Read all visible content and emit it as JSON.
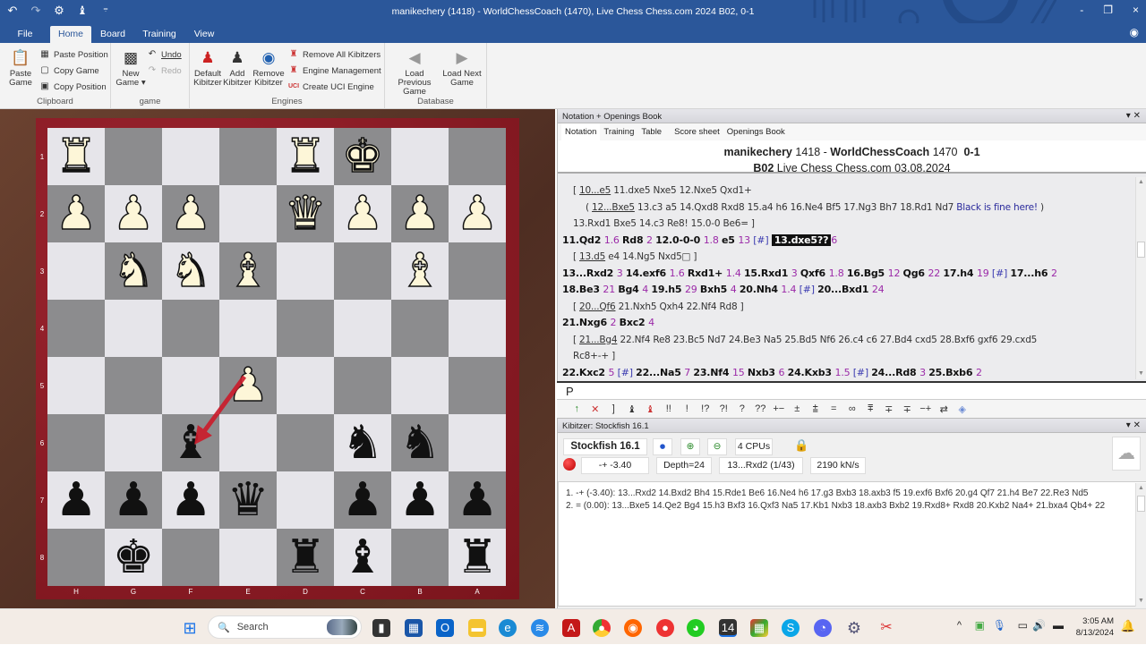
{
  "window": {
    "title": "manikechery (1418) - WorldChessCoach (1470), Live Chess Chess.com 2024  B02, 0-1",
    "qat_icons": [
      "undo-icon",
      "redo-icon",
      "settings-gear-icon",
      "tools-icon",
      "customize-icon"
    ],
    "controls": {
      "minimize": "-",
      "restore": "❐",
      "close": "×"
    }
  },
  "menu": {
    "tabs": [
      {
        "label": "File",
        "active": false
      },
      {
        "label": "Home",
        "active": true
      },
      {
        "label": "Board",
        "active": false
      },
      {
        "label": "Training",
        "active": false
      },
      {
        "label": "View",
        "active": false
      }
    ]
  },
  "ribbon": {
    "clipboard": {
      "label": "Clipboard",
      "paste_game": "Paste Game",
      "paste_position": "Paste Position",
      "copy_game": "Copy Game",
      "copy_position": "Copy Position"
    },
    "game": {
      "label": "game",
      "new_game": "New Game",
      "undo": "Undo",
      "redo": "Redo"
    },
    "engines": {
      "label": "Engines",
      "default_kibitzer": "Default Kibitzer",
      "add_kibitzer": "Add Kibitzer",
      "remove_kibitzer": "Remove Kibitzer",
      "remove_all_kibitzers": "Remove All Kibitzers",
      "engine_management": "Engine Management",
      "create_uci_engine": "Create UCI Engine"
    },
    "database": {
      "label": "Database",
      "load_previous": "Load Previous Game",
      "load_next": "Load Next Game"
    }
  },
  "board": {
    "orientation": "black",
    "rank_labels": [
      "1",
      "2",
      "3",
      "4",
      "5",
      "6",
      "7",
      "8"
    ],
    "file_labels": [
      "H",
      "G",
      "F",
      "E",
      "D",
      "C",
      "B",
      "A"
    ],
    "rows": [
      [
        "wR",
        "",
        "",
        "",
        "wR",
        "wK",
        "",
        ""
      ],
      [
        "wP",
        "wP",
        "wP",
        "",
        "wQ",
        "wP",
        "wP",
        "wP"
      ],
      [
        "",
        "wN",
        "wN",
        "wB",
        "",
        "",
        "wB",
        ""
      ],
      [
        "",
        "",
        "",
        "",
        "",
        "",
        "",
        ""
      ],
      [
        "",
        "",
        "",
        "wP",
        "",
        "",
        "",
        ""
      ],
      [
        "",
        "",
        "bB",
        "",
        "",
        "bN",
        "bN",
        ""
      ],
      [
        "bP",
        "bP",
        "bP",
        "bQ",
        "",
        "bP",
        "bP",
        "bP"
      ],
      [
        "",
        "bK",
        "",
        "",
        "bR",
        "bB",
        "",
        "bR"
      ]
    ],
    "arrow": {
      "from": "e5",
      "to": "f6",
      "color": "#cc1a2a"
    }
  },
  "notation": {
    "panel_title": "Notation + Openings Book",
    "tabs": [
      "Notation",
      "Training",
      "Table",
      "Score sheet",
      "Openings Book"
    ],
    "active_tab": "Notation",
    "white_player": "manikechery",
    "white_elo": "1418",
    "black_player": "WorldChessCoach",
    "black_elo": "1470",
    "result": "0-1",
    "eco": "B02",
    "event": "Live Chess Chess.com 03.08.2024",
    "lines": {
      "l1": {
        "a": "10...e5",
        "b": " 11.dxe5  Nxe5  12.Nxe5  Qxd1+"
      },
      "l2": {
        "a": "12...Bxe5",
        "b": " 13.c3  a5  14.Qxd8  Rxd8  15.a4  h6  16.Ne4  Bf5  17.Ng3  Bh7  18.Rd1  Nd7 ",
        "c": "Black is fine here!",
        "d": " )"
      },
      "l3": "13.Rxd1  Bxe5  14.c3  Re8!  15.0-0  Be6= ]",
      "l4": [
        {
          "m": "11.Qd2",
          "e": "1.6"
        },
        {
          "m": "Rd8",
          "e": "2"
        },
        {
          "m": "12.0-0-0",
          "e": "1.8"
        },
        {
          "m": "e5",
          "e": "13",
          "h": "[#]"
        }
      ],
      "l4_current": "13.dxe5??",
      "l4_current_eval": "6",
      "l5": {
        "a": "13.d5",
        "b": "  e4  14.Ng5  Nxd5□ ]"
      },
      "l6": [
        {
          "m": "13...Rxd2",
          "e": "3"
        },
        {
          "m": "14.exf6",
          "e": "1.6"
        },
        {
          "m": "Rxd1+",
          "e": "1.4"
        },
        {
          "m": "15.Rxd1",
          "e": "3"
        },
        {
          "m": "Qxf6",
          "e": "1.8"
        },
        {
          "m": "16.Bg5",
          "e": "12"
        },
        {
          "m": "Qg6",
          "e": "22"
        },
        {
          "m": "17.h4",
          "e": "19",
          "h": "[#]"
        },
        {
          "m": "17...h6",
          "e": "2"
        }
      ],
      "l7": [
        {
          "m": "18.Be3",
          "e": "21"
        },
        {
          "m": "Bg4",
          "e": "4"
        },
        {
          "m": "19.h5",
          "e": "29"
        },
        {
          "m": "Bxh5",
          "e": "4"
        },
        {
          "m": "20.Nh4",
          "e": "1.4",
          "h": "[#]"
        },
        {
          "m": "20...Bxd1",
          "e": "24"
        }
      ],
      "l8": {
        "a": "20...Qf6",
        "b": "  21.Nxh5  Qxh4  22.Nf4  Rd8 ]"
      },
      "l9": [
        {
          "m": "21.Nxg6",
          "e": "2"
        },
        {
          "m": "Bxc2",
          "e": "4"
        }
      ],
      "l10": {
        "a": "21...Bg4",
        "b": "  22.Nf4  Re8  23.Bc5  Nd7  24.Be3  Na5  25.Bd5  Nf6  26.c4  c6  27.Bd4  cxd5  28.Bxf6  gxf6  29.cxd5"
      },
      "l11": "Rc8+-+ ]",
      "l12": [
        {
          "m": "22.Kxc2",
          "e": "5",
          "h": "[#]"
        },
        {
          "m": "22...Na5",
          "e": "7"
        },
        {
          "m": "23.Nf4",
          "e": "15"
        },
        {
          "m": "Nxb3",
          "e": "6"
        },
        {
          "m": "24.Kxb3",
          "e": "1.5",
          "h": "[#]"
        },
        {
          "m": "24...Rd8",
          "e": "3"
        },
        {
          "m": "25.Bxb6",
          "e": "2"
        }
      ]
    },
    "input_value": "P",
    "symbols": [
      "↑",
      "✕",
      "]",
      "♝",
      "♝",
      "!!",
      "!",
      "!?",
      "?!",
      "?",
      "??",
      "+−",
      "±",
      "⩲",
      "=",
      "∞",
      "⩱",
      "∓",
      "∓",
      "−+",
      "⇄",
      "◈"
    ]
  },
  "kibitzer": {
    "panel_title": "Kibitzer: Stockfish 16.1",
    "engine_name": "Stockfish 16.1",
    "cpus": "4 CPUs",
    "evaluation": "-+ -3.40",
    "depth": "Depth=24",
    "current_move": "13...Rxd2 (1/43)",
    "speed": "2190 kN/s",
    "lines": [
      "1. -+ (-3.40): 13...Rxd2 14.Bxd2 Bh4 15.Rde1 Be6 16.Ne4 h6 17.g3 Bxb3 18.axb3 f5 19.exf6 Bxf6 20.g4 Qf7 21.h4 Be7 22.Re3 Nd5",
      "2. = (0.00): 13...Bxe5 14.Qe2 Bg4 15.h3 Bxf3 16.Qxf3 Na5 17.Kb1 Nxb3 18.axb3 Bxb2 19.Rxd8+ Rxd8 20.Kxb2 Na4+ 21.bxa4 Qb4+ 22"
    ]
  },
  "taskbar": {
    "search_placeholder": "Search",
    "time": "3:05 AM",
    "date": "8/13/2024"
  }
}
